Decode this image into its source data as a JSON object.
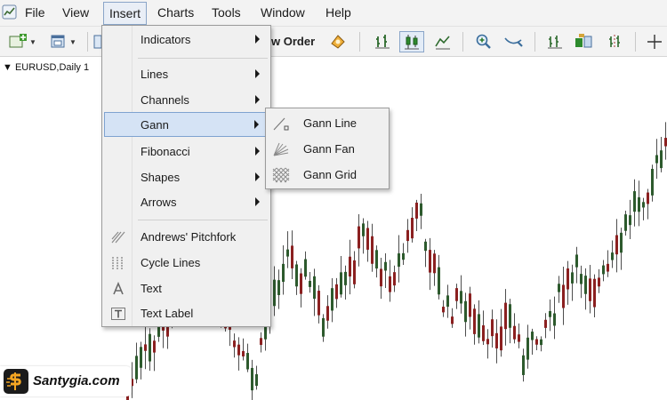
{
  "menubar": {
    "items": [
      "File",
      "View",
      "Insert",
      "Charts",
      "Tools",
      "Window",
      "Help"
    ],
    "active": "Insert"
  },
  "toolbar": {
    "new_order_label": "w Order",
    "icons": [
      "new-chart-icon",
      "profiles-icon",
      "autotrading-icon",
      "bar-chart-icon",
      "candlestick-icon",
      "line-chart-icon",
      "zoom-in-icon",
      "zoom-out-icon",
      "tile-windows-icon",
      "chart-shift-icon",
      "period-separators-icon",
      "crosshair-icon"
    ]
  },
  "chart": {
    "title": "EURUSD,Daily",
    "title_suffix": "1",
    "bull_color": "#2d5a2d",
    "bear_color": "#8b2020"
  },
  "insert_menu": {
    "items": [
      {
        "label": "Indicators",
        "submenu": true
      },
      {
        "label": "Lines",
        "submenu": true
      },
      {
        "label": "Channels",
        "submenu": true
      },
      {
        "label": "Gann",
        "submenu": true,
        "highlighted": true
      },
      {
        "label": "Fibonacci",
        "submenu": true
      },
      {
        "label": "Shapes",
        "submenu": true
      },
      {
        "label": "Arrows",
        "submenu": true
      },
      {
        "label": "Andrews' Pitchfork",
        "icon": "pitchfork-icon"
      },
      {
        "label": "Cycle Lines",
        "icon": "cycle-lines-icon"
      },
      {
        "label": "Text",
        "icon": "text-icon"
      },
      {
        "label": "Text Label",
        "icon": "text-label-icon"
      }
    ]
  },
  "gann_submenu": {
    "items": [
      {
        "label": "Gann Line",
        "icon": "gann-line-icon"
      },
      {
        "label": "Gann Fan",
        "icon": "gann-fan-icon"
      },
      {
        "label": "Gann Grid",
        "icon": "gann-grid-icon"
      }
    ]
  },
  "watermark": {
    "text": "Santygia.com",
    "logo_color": "#f5a623"
  }
}
